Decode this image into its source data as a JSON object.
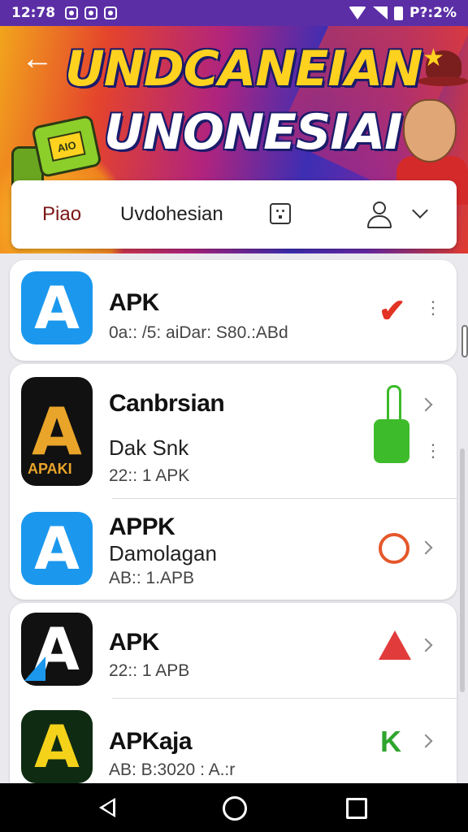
{
  "status_bar": {
    "time": "12:78",
    "battery_text": "P?:2%"
  },
  "banner": {
    "title_line1": "UNDCANEIAN",
    "title_line2": "UNONESIAI",
    "robot_face_text": "AIO"
  },
  "tabs": [
    {
      "label": "Piao"
    },
    {
      "label": "Uvdohesian"
    }
  ],
  "apps": [
    {
      "name": "APK",
      "subtitle": "",
      "meta": "0a:: /5: aiDar: S80.:ABd",
      "icon_label": ""
    },
    {
      "name": "Canbrsian",
      "subtitle": "Dak Snk",
      "meta": "22:: 1 APK",
      "icon_label": "APAKI"
    },
    {
      "name": "APPK",
      "subtitle": "Damolagan",
      "meta": "AB:: 1.APB",
      "icon_label": ""
    },
    {
      "name": "APK",
      "subtitle": "",
      "meta": "22:: 1 APB",
      "icon_label": ""
    },
    {
      "name": "APKaja",
      "subtitle": "",
      "meta": "AB: B:3020 : A.:r",
      "icon_label": ""
    }
  ],
  "colors": {
    "status_bar": "#5b2ea5",
    "accent_red": "#7a1515",
    "app_blue": "#1b98ee"
  }
}
